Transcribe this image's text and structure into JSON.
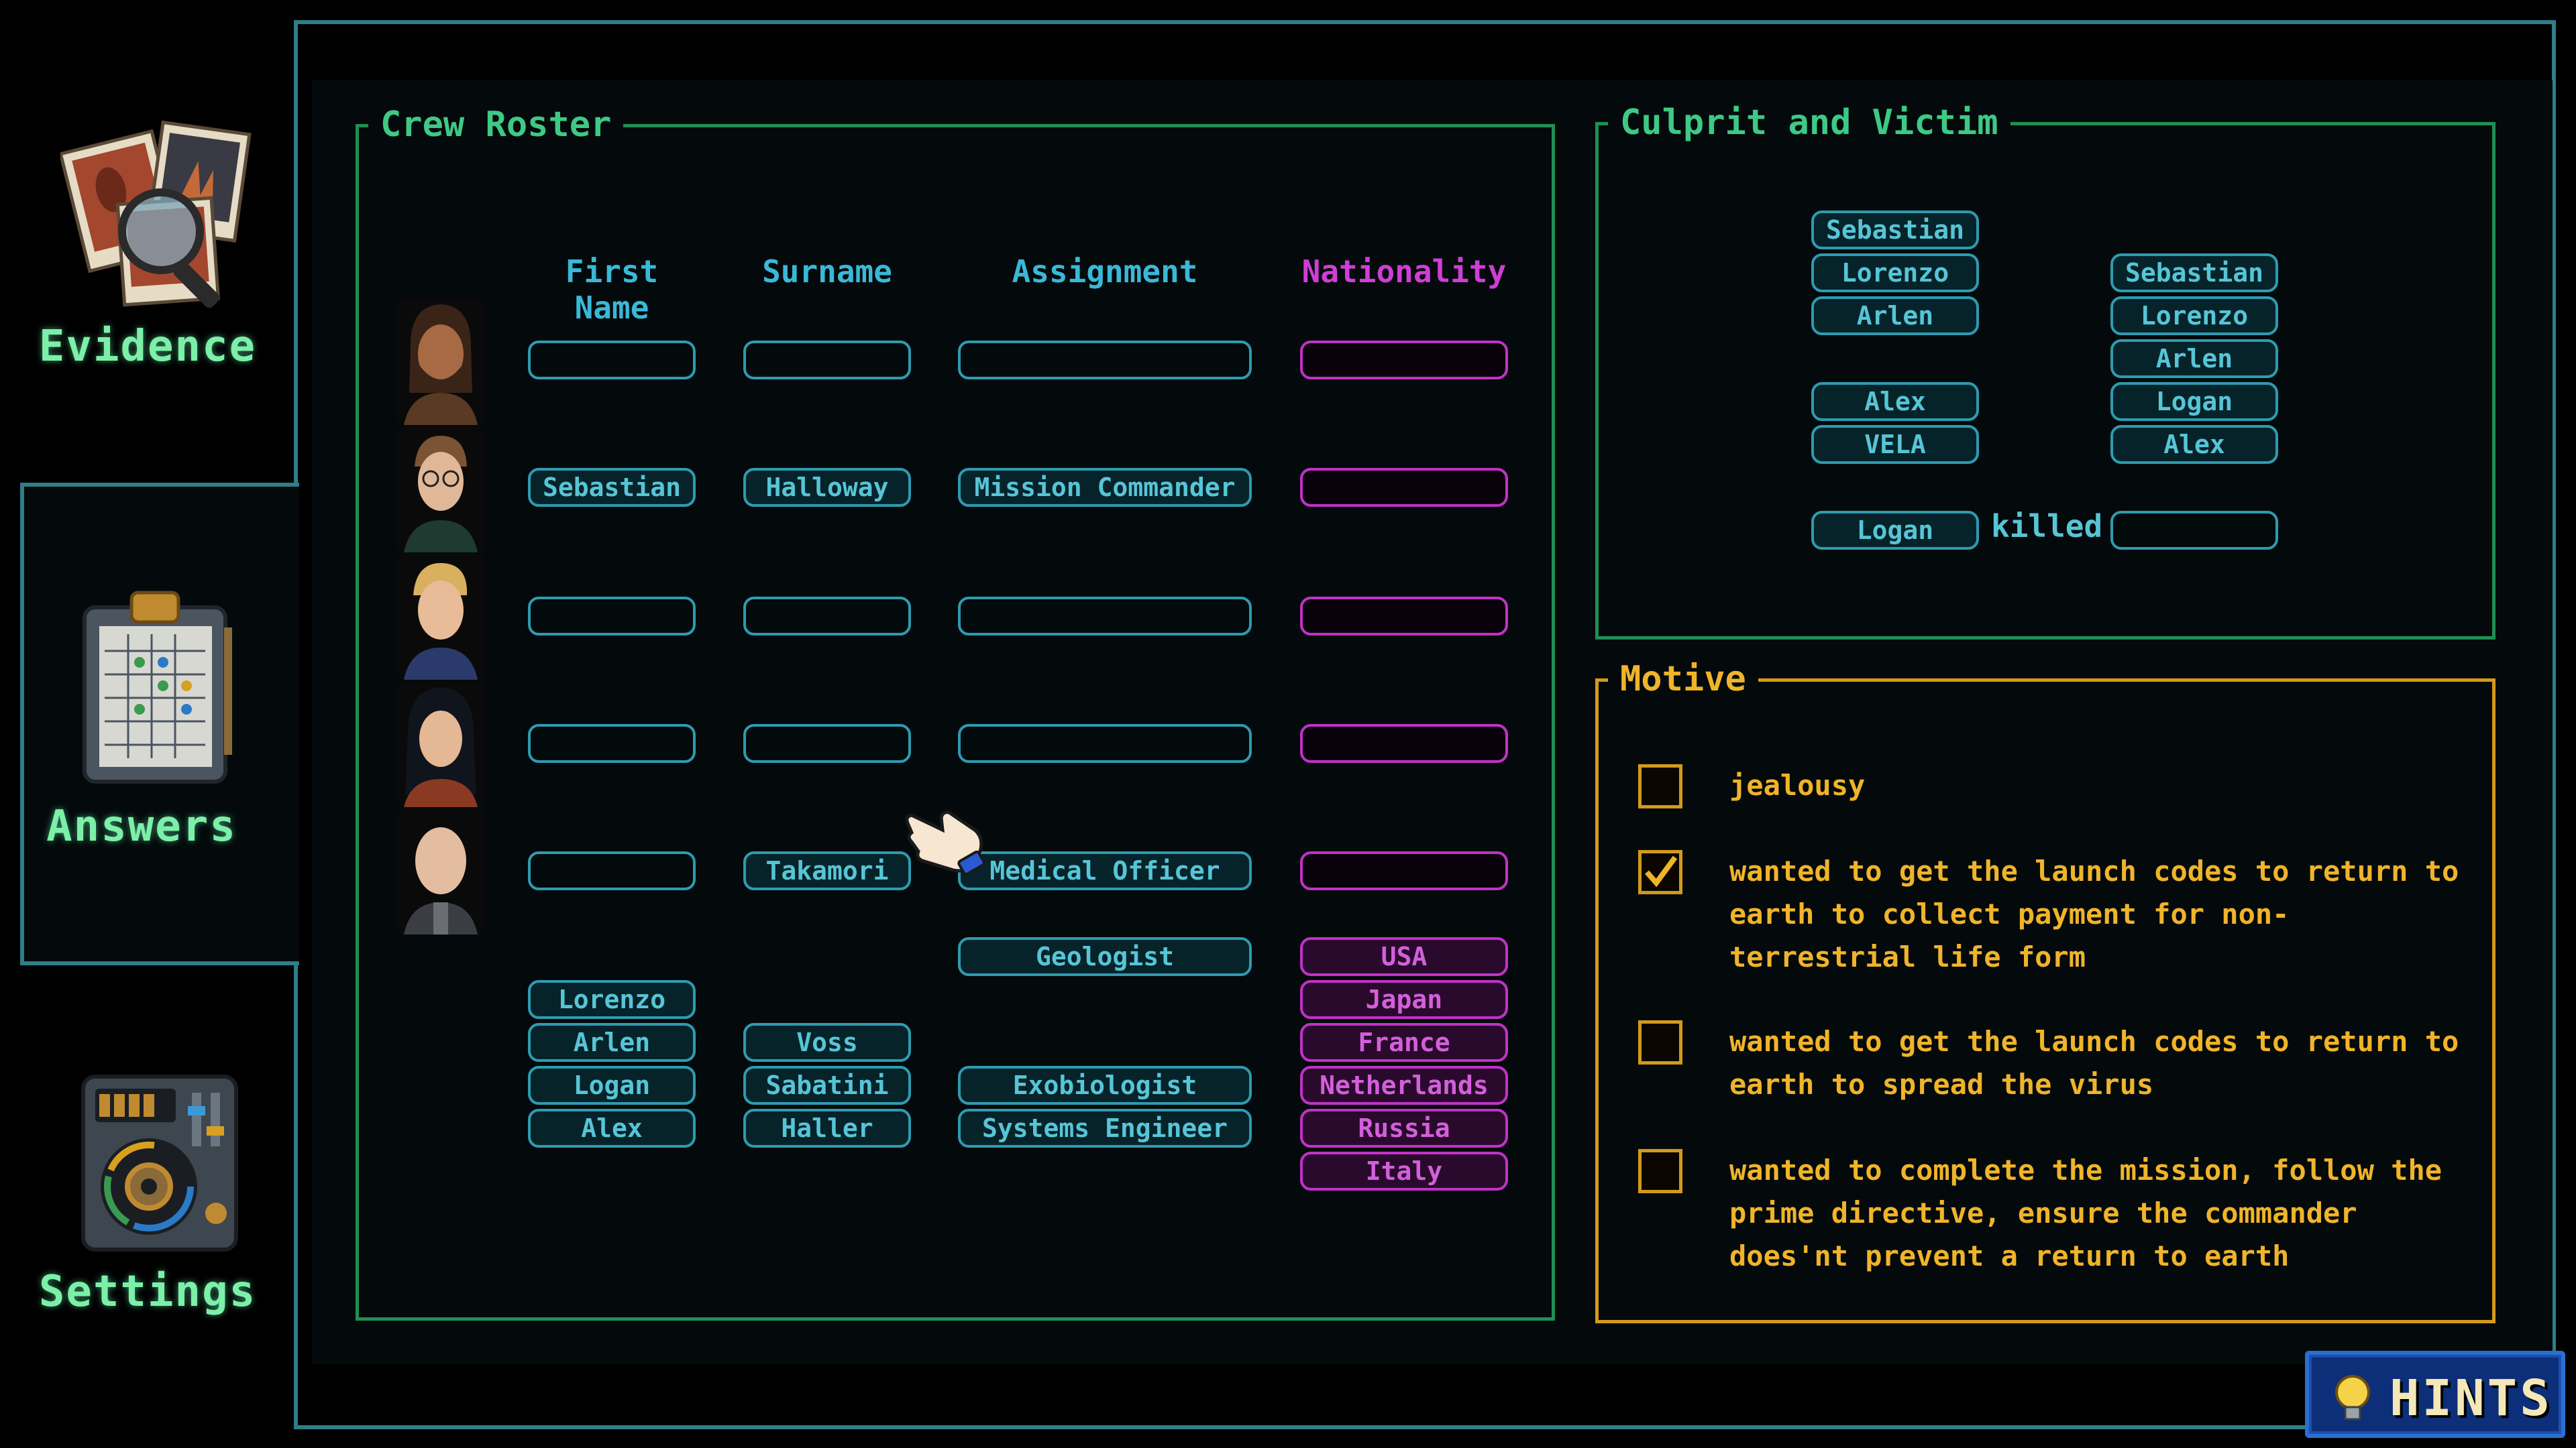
{
  "sidebar": {
    "evidence_label": "Evidence",
    "answers_label": "Answers",
    "settings_label": "Settings",
    "icons": [
      "evidence-photos-icon",
      "clipboard-checklist-icon",
      "settings-panel-icon"
    ]
  },
  "crew_roster": {
    "title": "Crew Roster",
    "headers": {
      "first_name": "First Name",
      "surname": "Surname",
      "assignment": "Assignment",
      "nationality": "Nationality"
    },
    "rows": [
      {
        "first_name": "",
        "surname": "",
        "assignment": "",
        "nationality": ""
      },
      {
        "first_name": "Sebastian",
        "surname": "Halloway",
        "assignment": "Mission Commander",
        "nationality": ""
      },
      {
        "first_name": "",
        "surname": "",
        "assignment": "",
        "nationality": ""
      },
      {
        "first_name": "",
        "surname": "",
        "assignment": "",
        "nationality": ""
      },
      {
        "first_name": "",
        "surname": "Takamori",
        "assignment": "Medical Officer",
        "nationality": ""
      }
    ],
    "pool": {
      "first_names": [
        "Lorenzo",
        "Arlen",
        "Logan",
        "Alex"
      ],
      "surnames": [
        "Voss",
        "Sabatini",
        "Haller"
      ],
      "assignments": [
        "Geologist",
        "Exobiologist",
        "Systems Engineer"
      ],
      "nationalities": [
        "USA",
        "Japan",
        "France",
        "Netherlands",
        "Russia",
        "Italy"
      ]
    }
  },
  "culprit_victim": {
    "title": "Culprit and Victim",
    "culprit_options": [
      "Sebastian",
      "Lorenzo",
      "Arlen",
      "Alex",
      "VELA"
    ],
    "victim_options": [
      "Sebastian",
      "Lorenzo",
      "Arlen",
      "Logan",
      "Alex"
    ],
    "culprit_selected": "Logan",
    "verb": "killed",
    "victim_selected": ""
  },
  "motive": {
    "title": "Motive",
    "options": [
      {
        "text": "jealousy",
        "checked": false
      },
      {
        "text": "wanted to get the launch codes to return to earth to collect payment for non-terrestrial life form",
        "checked": true
      },
      {
        "text": "wanted to get the launch codes to return to earth to spread the virus",
        "checked": false
      },
      {
        "text": "wanted to complete the mission, follow the prime directive, ensure the commander does'nt prevent a return to earth",
        "checked": false
      }
    ]
  },
  "hints": {
    "label": "HINTS"
  },
  "colors": {
    "cyan": "#2e9bb0",
    "magenta": "#c231c8",
    "green": "#1f8f55",
    "amber": "#d69a18",
    "hints_blue": "#0d2e78"
  }
}
